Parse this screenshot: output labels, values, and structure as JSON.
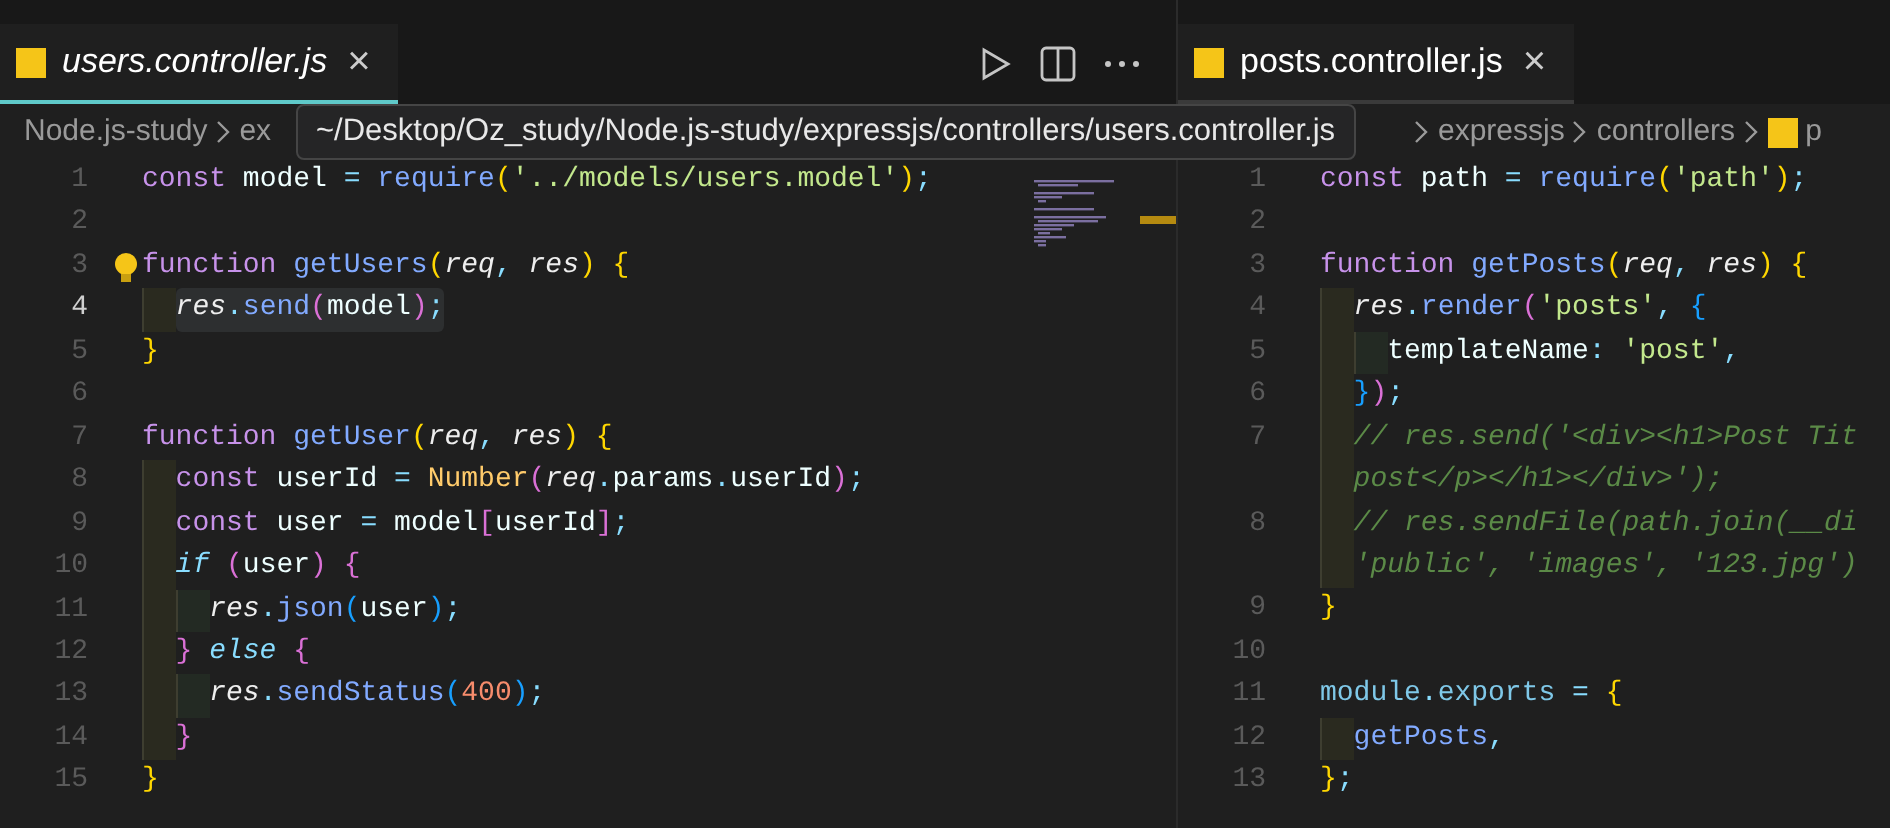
{
  "tooltip": "~/Desktop/Oz_study/Node.js-study/expressjs/controllers/users.controller.js",
  "panes": [
    {
      "tab": {
        "label": "users.controller.js",
        "close": "×",
        "preview": true,
        "focused": true
      },
      "toolbar": true,
      "breadcrumb": [
        {
          "text": "Node.js-study"
        },
        {
          "text": "ex"
        }
      ],
      "minimap": true,
      "lines": [
        {
          "num": "1",
          "rows": [
            [
              {
                "kind": "keyword",
                "text": "const"
              },
              {
                "kind": "variable",
                "text": " model"
              },
              {
                "kind": "punct",
                "text": " ="
              },
              {
                "kind": "function",
                "text": " require"
              },
              {
                "kind": "bracket1",
                "text": "("
              },
              {
                "kind": "string",
                "text": "'../models/users.model'"
              },
              {
                "kind": "bracket1",
                "text": ")"
              },
              {
                "kind": "punct",
                "text": ";"
              }
            ]
          ]
        },
        {
          "num": "2",
          "rows": [
            []
          ]
        },
        {
          "num": "3",
          "bulb": true,
          "rows": [
            [
              {
                "kind": "keyword",
                "text": "function"
              },
              {
                "kind": "function",
                "text": " getUsers"
              },
              {
                "kind": "bracket1",
                "text": "("
              },
              {
                "kind": "param",
                "text": "req"
              },
              {
                "kind": "punct",
                "text": ","
              },
              {
                "kind": "param",
                "text": " res"
              },
              {
                "kind": "bracket1",
                "text": ")"
              },
              {
                "kind": "bracket1",
                "text": " {"
              }
            ]
          ]
        },
        {
          "num": "4",
          "current": true,
          "rows": [
            [
              {
                "kind": "indent",
                "text": "  "
              },
              {
                "kind": "param",
                "text": "res"
              },
              {
                "kind": "punct",
                "text": "."
              },
              {
                "kind": "function",
                "text": "send"
              },
              {
                "kind": "bracket2",
                "text": "("
              },
              {
                "kind": "variable",
                "text": "model"
              },
              {
                "kind": "bracket2",
                "text": ")"
              },
              {
                "kind": "punct",
                "text": ";"
              }
            ]
          ]
        },
        {
          "num": "5",
          "rows": [
            [
              {
                "kind": "bracket1",
                "text": "}"
              }
            ]
          ]
        },
        {
          "num": "6",
          "rows": [
            []
          ]
        },
        {
          "num": "7",
          "rows": [
            [
              {
                "kind": "keyword",
                "text": "function"
              },
              {
                "kind": "function",
                "text": " getUser"
              },
              {
                "kind": "bracket1",
                "text": "("
              },
              {
                "kind": "param",
                "text": "req"
              },
              {
                "kind": "punct",
                "text": ","
              },
              {
                "kind": "param",
                "text": " res"
              },
              {
                "kind": "bracket1",
                "text": ")"
              },
              {
                "kind": "bracket1",
                "text": " {"
              }
            ]
          ]
        },
        {
          "num": "8",
          "rows": [
            [
              {
                "kind": "indent",
                "text": "  "
              },
              {
                "kind": "keyword",
                "text": "const"
              },
              {
                "kind": "variable",
                "text": " userId"
              },
              {
                "kind": "punct",
                "text": " ="
              },
              {
                "kind": "class",
                "text": " Number"
              },
              {
                "kind": "bracket2",
                "text": "("
              },
              {
                "kind": "param",
                "text": "req"
              },
              {
                "kind": "punct",
                "text": "."
              },
              {
                "kind": "variable",
                "text": "params"
              },
              {
                "kind": "punct",
                "text": "."
              },
              {
                "kind": "variable",
                "text": "userId"
              },
              {
                "kind": "bracket2",
                "text": ")"
              },
              {
                "kind": "punct",
                "text": ";"
              }
            ]
          ]
        },
        {
          "num": "9",
          "rows": [
            [
              {
                "kind": "indent",
                "text": "  "
              },
              {
                "kind": "keyword",
                "text": "const"
              },
              {
                "kind": "variable",
                "text": " user"
              },
              {
                "kind": "punct",
                "text": " ="
              },
              {
                "kind": "variable",
                "text": " model"
              },
              {
                "kind": "bracket2",
                "text": "["
              },
              {
                "kind": "variable",
                "text": "userId"
              },
              {
                "kind": "bracket2",
                "text": "]"
              },
              {
                "kind": "punct",
                "text": ";"
              }
            ]
          ]
        },
        {
          "num": "10",
          "rows": [
            [
              {
                "kind": "indent",
                "text": "  "
              },
              {
                "kind": "control",
                "text": "if"
              },
              {
                "kind": "bracket2",
                "text": " ("
              },
              {
                "kind": "variable",
                "text": "user"
              },
              {
                "kind": "bracket2",
                "text": ")"
              },
              {
                "kind": "bracket2",
                "text": " {"
              }
            ]
          ]
        },
        {
          "num": "11",
          "rows": [
            [
              {
                "kind": "indent",
                "text": "    "
              },
              {
                "kind": "param",
                "text": "res"
              },
              {
                "kind": "punct",
                "text": "."
              },
              {
                "kind": "function",
                "text": "json"
              },
              {
                "kind": "bracket3",
                "text": "("
              },
              {
                "kind": "variable",
                "text": "user"
              },
              {
                "kind": "bracket3",
                "text": ")"
              },
              {
                "kind": "punct",
                "text": ";"
              }
            ]
          ]
        },
        {
          "num": "12",
          "rows": [
            [
              {
                "kind": "indent",
                "text": "  "
              },
              {
                "kind": "bracket2",
                "text": "}"
              },
              {
                "kind": "control",
                "text": " else"
              },
              {
                "kind": "bracket2",
                "text": " {"
              }
            ]
          ]
        },
        {
          "num": "13",
          "rows": [
            [
              {
                "kind": "indent",
                "text": "    "
              },
              {
                "kind": "param",
                "text": "res"
              },
              {
                "kind": "punct",
                "text": "."
              },
              {
                "kind": "function",
                "text": "sendStatus"
              },
              {
                "kind": "bracket3",
                "text": "("
              },
              {
                "kind": "number",
                "text": "400"
              },
              {
                "kind": "bracket3",
                "text": ")"
              },
              {
                "kind": "punct",
                "text": ";"
              }
            ]
          ]
        },
        {
          "num": "14",
          "rows": [
            [
              {
                "kind": "indent",
                "text": "  "
              },
              {
                "kind": "bracket2",
                "text": "}"
              }
            ]
          ]
        },
        {
          "num": "15",
          "rows": [
            [
              {
                "kind": "bracket1",
                "text": "}"
              }
            ]
          ]
        }
      ]
    },
    {
      "tab": {
        "label": "posts.controller.js",
        "close": "×",
        "preview": false,
        "focused": false
      },
      "breadcrumb": [
        {
          "text": "expressjs"
        },
        {
          "text": "controllers"
        },
        {
          "text": "p",
          "js": true
        }
      ],
      "lines": [
        {
          "num": "1",
          "rows": [
            [
              {
                "kind": "keyword",
                "text": "const"
              },
              {
                "kind": "variable",
                "text": " path"
              },
              {
                "kind": "punct",
                "text": " ="
              },
              {
                "kind": "function",
                "text": " require"
              },
              {
                "kind": "bracket1",
                "text": "("
              },
              {
                "kind": "string",
                "text": "'path'"
              },
              {
                "kind": "bracket1",
                "text": ")"
              },
              {
                "kind": "punct",
                "text": ";"
              }
            ]
          ]
        },
        {
          "num": "2",
          "rows": [
            []
          ]
        },
        {
          "num": "3",
          "rows": [
            [
              {
                "kind": "keyword",
                "text": "function"
              },
              {
                "kind": "function",
                "text": " getPosts"
              },
              {
                "kind": "bracket1",
                "text": "("
              },
              {
                "kind": "param",
                "text": "req"
              },
              {
                "kind": "punct",
                "text": ","
              },
              {
                "kind": "param",
                "text": " res"
              },
              {
                "kind": "bracket1",
                "text": ")"
              },
              {
                "kind": "bracket1",
                "text": " {"
              }
            ]
          ]
        },
        {
          "num": "4",
          "rows": [
            [
              {
                "kind": "indent",
                "text": "  "
              },
              {
                "kind": "param",
                "text": "res"
              },
              {
                "kind": "punct",
                "text": "."
              },
              {
                "kind": "function",
                "text": "render"
              },
              {
                "kind": "bracket2",
                "text": "("
              },
              {
                "kind": "string",
                "text": "'posts'"
              },
              {
                "kind": "punct",
                "text": ","
              },
              {
                "kind": "bracket3",
                "text": " {"
              }
            ]
          ]
        },
        {
          "num": "5",
          "rows": [
            [
              {
                "kind": "indent",
                "text": "    "
              },
              {
                "kind": "variable",
                "text": "templateName"
              },
              {
                "kind": "punct",
                "text": ":"
              },
              {
                "kind": "string",
                "text": " 'post'"
              },
              {
                "kind": "punct",
                "text": ","
              }
            ]
          ]
        },
        {
          "num": "6",
          "rows": [
            [
              {
                "kind": "indent",
                "text": "  "
              },
              {
                "kind": "bracket3",
                "text": "}"
              },
              {
                "kind": "bracket2",
                "text": ")"
              },
              {
                "kind": "punct",
                "text": ";"
              }
            ]
          ]
        },
        {
          "num": "7",
          "rows": [
            [
              {
                "kind": "indent",
                "text": "  "
              },
              {
                "kind": "comment",
                "text": "// res.send('<div><h1>Post Tit"
              }
            ],
            [
              {
                "kind": "indent",
                "text": "  "
              },
              {
                "kind": "comment",
                "text": "post</p></h1></div>');"
              }
            ]
          ]
        },
        {
          "num": "8",
          "rows": [
            [
              {
                "kind": "indent",
                "text": "  "
              },
              {
                "kind": "comment",
                "text": "// res.sendFile(path.join(__di"
              }
            ],
            [
              {
                "kind": "indent",
                "text": "  "
              },
              {
                "kind": "comment",
                "text": "'public', 'images', '123.jpg')"
              }
            ]
          ]
        },
        {
          "num": "9",
          "rows": [
            [
              {
                "kind": "bracket1",
                "text": "}"
              }
            ]
          ]
        },
        {
          "num": "10",
          "rows": [
            []
          ]
        },
        {
          "num": "11",
          "rows": [
            [
              {
                "kind": "property",
                "text": "module"
              },
              {
                "kind": "punct",
                "text": "."
              },
              {
                "kind": "property",
                "text": "exports"
              },
              {
                "kind": "punct",
                "text": " ="
              },
              {
                "kind": "bracket1",
                "text": " {"
              }
            ]
          ]
        },
        {
          "num": "12",
          "rows": [
            [
              {
                "kind": "indent",
                "text": "  "
              },
              {
                "kind": "function",
                "text": "getPosts"
              },
              {
                "kind": "punct",
                "text": ","
              }
            ]
          ]
        },
        {
          "num": "13",
          "rows": [
            [
              {
                "kind": "bracket1",
                "text": "}"
              },
              {
                "kind": "punct",
                "text": ";"
              }
            ]
          ]
        }
      ]
    }
  ]
}
